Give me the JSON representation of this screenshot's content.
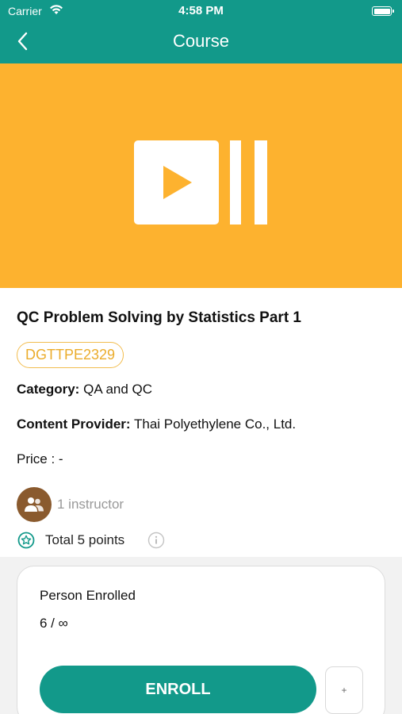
{
  "status_bar": {
    "carrier": "Carrier",
    "time": "4:58 PM",
    "wifi_icon": "wifi-icon",
    "battery_icon": "battery-icon"
  },
  "nav": {
    "title": "Course",
    "back_icon": "chevron-left-icon"
  },
  "hero": {
    "background_color": "#fdb22f",
    "icon": "video-play-icon"
  },
  "course": {
    "title": "QC Problem Solving by Statistics Part 1",
    "code": "DGTTPE2329",
    "category_label": "Category:",
    "category_value": "QA and QC",
    "provider_label": "Content Provider:",
    "provider_value": "Thai Polyethylene Co., Ltd.",
    "price": "Price : -",
    "instructors": "1 instructor",
    "points": "Total 5 points"
  },
  "enrollment": {
    "label": "Person Enrolled",
    "value": "6 / ∞",
    "enroll_label": "ENROLL",
    "plus_label": "+"
  },
  "colors": {
    "primary": "#12998a",
    "accent": "#fdb22f",
    "badge": "#ebac2b"
  }
}
